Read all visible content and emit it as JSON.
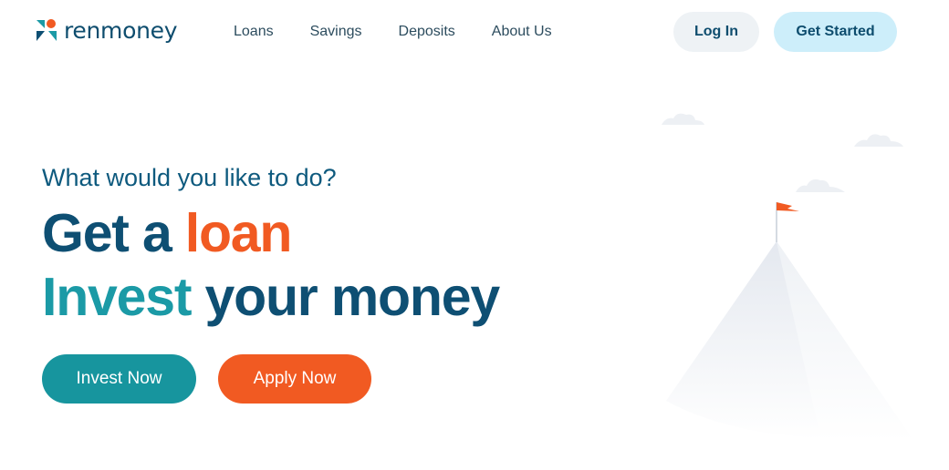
{
  "brand": {
    "name": "renmoney",
    "colors": {
      "navy": "#0e4f73",
      "teal": "#1b9aa6",
      "orange": "#f15a22",
      "sky": "#cdeefa"
    }
  },
  "nav": {
    "items": [
      {
        "label": "Loans"
      },
      {
        "label": "Savings"
      },
      {
        "label": "Deposits"
      },
      {
        "label": "About Us"
      }
    ]
  },
  "header": {
    "login_label": "Log In",
    "get_started_label": "Get Started"
  },
  "hero": {
    "question": "What would you like to do?",
    "line1": {
      "part1": "Get a ",
      "part2": "loan"
    },
    "line2": {
      "part1": "Invest",
      "part2": " your money"
    },
    "invest_button": "Invest Now",
    "apply_button": "Apply Now"
  },
  "illustration": {
    "icons": [
      "cloud-icon",
      "cloud-icon",
      "cloud-icon",
      "mountain-icon",
      "flag-icon"
    ]
  }
}
